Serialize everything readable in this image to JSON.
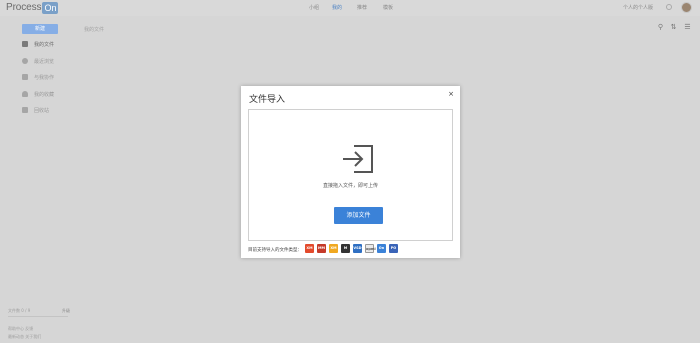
{
  "app": {
    "logo_text": "Process",
    "logo_badge": "On"
  },
  "nav": {
    "items": [
      {
        "label": "小组",
        "active": false
      },
      {
        "label": "我的",
        "active": true
      },
      {
        "label": "推荐",
        "active": false
      },
      {
        "label": "模板",
        "active": false
      }
    ],
    "user_label": "个人的个人版"
  },
  "sidebar": {
    "new_label": "新建",
    "items": [
      {
        "label": "我的文件",
        "icon": "home-icon",
        "active": true
      },
      {
        "label": "最近浏览",
        "icon": "clock-icon",
        "active": false
      },
      {
        "label": "与我协作",
        "icon": "people-icon",
        "active": false
      },
      {
        "label": "我的收藏",
        "icon": "heart-icon",
        "active": false
      },
      {
        "label": "回收站",
        "icon": "trash-icon",
        "active": false
      }
    ],
    "storage_label": "文件数 0 / 9",
    "upgrade_label": "升级",
    "storage_fraction": 0,
    "footer": [
      "帮助中心  反馈",
      "最新动态  关于我们"
    ]
  },
  "main": {
    "breadcrumb": "我的文件"
  },
  "dialog": {
    "title": "文件导入",
    "close_symbol": "×",
    "drop_hint": "直接拖入文件，即可上传",
    "add_button": "添加文件",
    "types_label": "目前支持导入的文件类型：",
    "file_types": [
      {
        "name": "XM",
        "color": "#e34a2c"
      },
      {
        "name": "MM",
        "color": "#c53a2a"
      },
      {
        "name": "XM",
        "color": "#f0a820"
      },
      {
        "name": "M",
        "color": "#333333"
      },
      {
        "name": "VSD",
        "color": "#2f6fc2"
      },
      {
        "name": "opml",
        "color": "#eaeaea"
      },
      {
        "name": "On",
        "color": "#3b82d8"
      },
      {
        "name": "PO",
        "color": "#3a64b8"
      }
    ]
  }
}
